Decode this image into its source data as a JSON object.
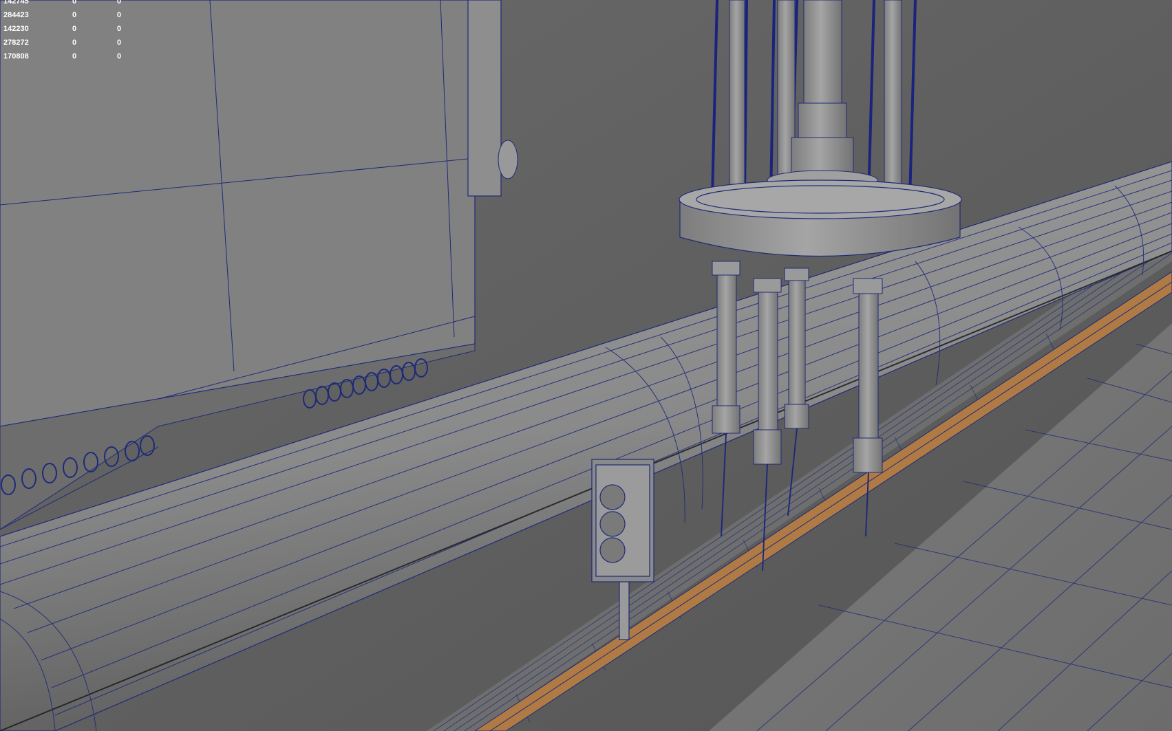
{
  "viewport": {
    "stats_rows": [
      {
        "label": "142745",
        "a": "0",
        "b": "0"
      },
      {
        "label": "284423",
        "a": "0",
        "b": "0"
      },
      {
        "label": "142230",
        "a": "0",
        "b": "0"
      },
      {
        "label": "278272",
        "a": "0",
        "b": "0"
      },
      {
        "label": "170808",
        "a": "0",
        "b": "0"
      }
    ]
  },
  "colors": {
    "background": "#5d5d5d",
    "wire": "#1a237e",
    "shaded_light": "#9a9a9a",
    "shaded_dark": "#5f5f5f",
    "rail_accent": "#b07a45"
  }
}
